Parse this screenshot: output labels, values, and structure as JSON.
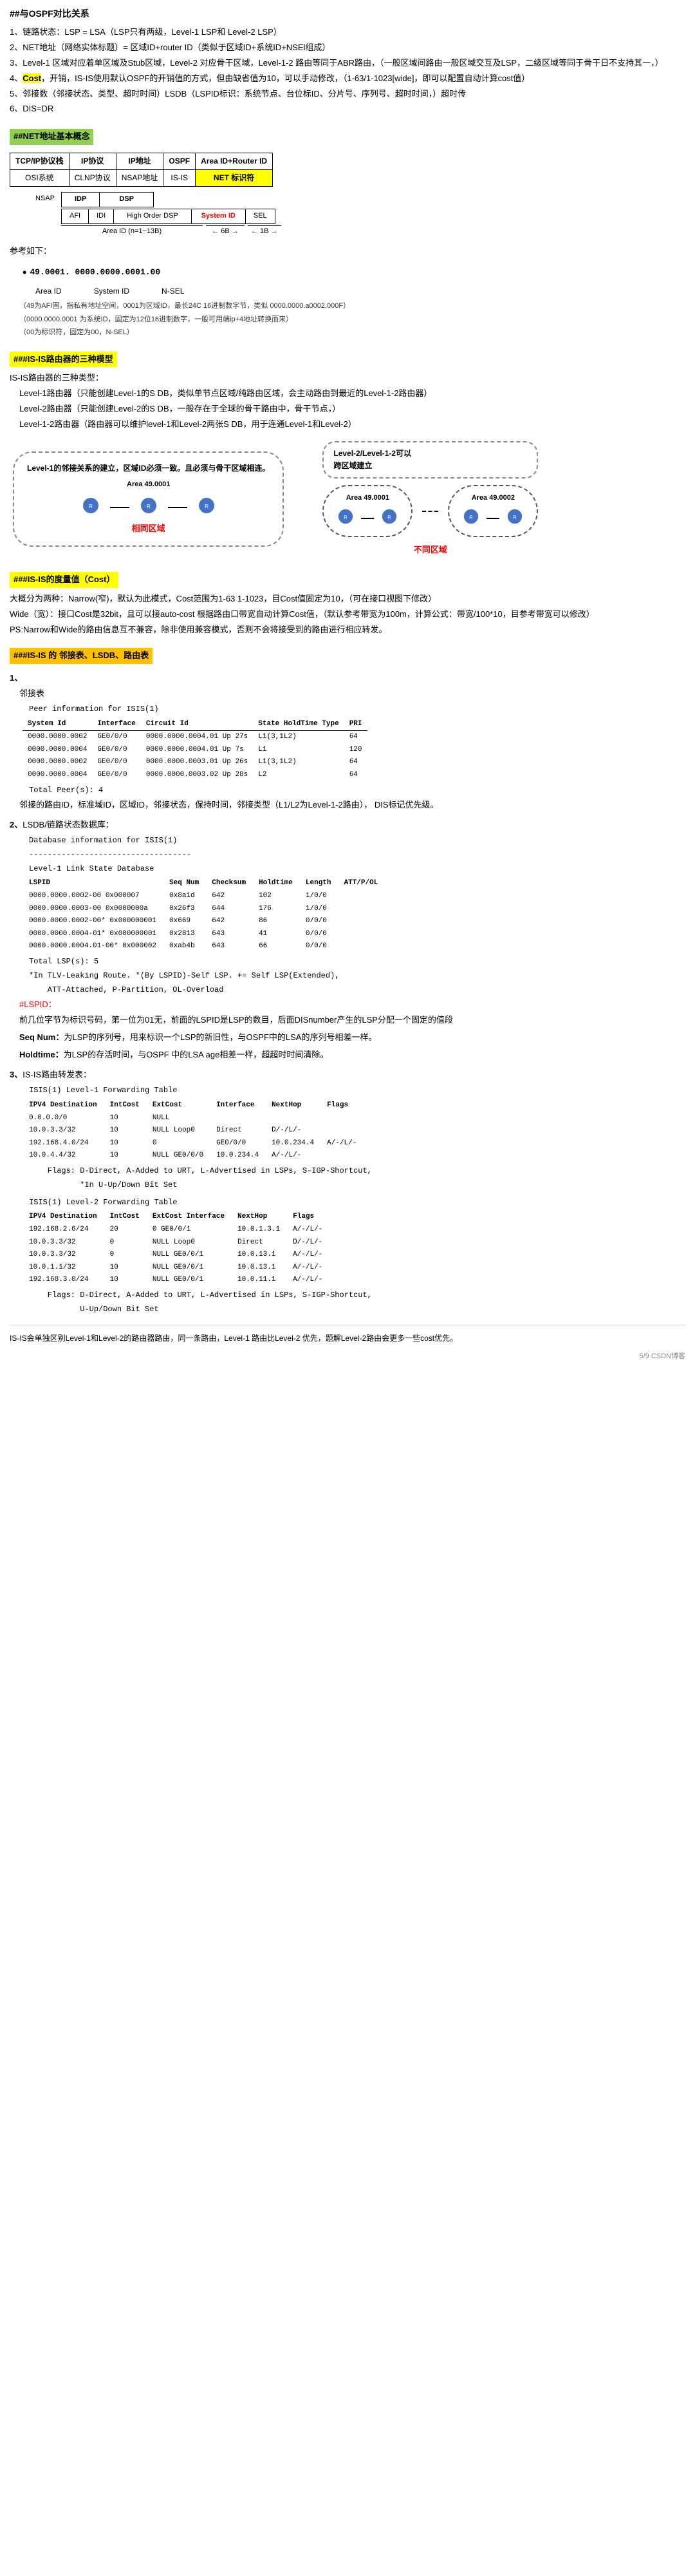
{
  "page": {
    "title": "##与OSPF对比关系",
    "footer": "5/9 CSDN博客"
  },
  "sections": {
    "ospf_compare": {
      "items": [
        "1、链路状态：LSP = LSA（LSP只有两级，Level-1 LSP和 Level-2 LSP）",
        "2、NET地址（网络实体标题）= 区域ID+router ID（类似于区域ID+系统ID+NSEl组成）",
        "3、Level-1 区域对应着单区域及Stub区域，Level-2 对应骨干区域，Level-1-2 路由等同于ABR路由，（一般区域间路由一般区域交互及LSP，二级区域等同于骨干日不支持其一，）",
        "4、Cost，开销，IS-IS使用默认OSPF的开销值的方式，但由缺省值为10，可以手动修改，（1-63/1-1023[wide]，即可以配置自动计算cost值）",
        "5、邻接数（邻接状态、类型、超时时间）LSDB（LSPID标识：系统节点、台位标ID、分片号、序列号、超时时间，）超时传",
        "6、DIS=DR"
      ]
    },
    "net_section": {
      "heading": "##NET地址基本概念",
      "table_headers": [
        "TCP/IP协议栈",
        "IP协议",
        "IP地址",
        "OSPF",
        "Area ID+Router ID"
      ],
      "table_row": [
        "OSI系统",
        "CLNP协议",
        "NSAP地址",
        "IS-IS",
        "NET 标识符"
      ],
      "nsap_label": "NSAP",
      "nsap_fields": [
        "IDP",
        "",
        "DSP"
      ],
      "nsap_sub_fields": [
        "AFI",
        "IDI",
        "High Order DSP",
        "System ID",
        "SEL"
      ],
      "area_id_label": "Area ID (n=1~13B)",
      "area_id_arrow": "← 6B →",
      "sel_arrow": "← 1B →"
    },
    "example": {
      "heading": "参考如下：",
      "addr": "49.0001. 0000.0000.0001.00",
      "area_id": "Area ID",
      "system_id": "System ID",
      "n_sel": "N-SEL",
      "note1": "（49为AFI固，指私有地址空间，0001为区域ID，最长24C 16进制数字节，类似 0000.0000.a0002.000F）",
      "note2": "（0000.0000.0001 为系统ID，固定为12位16进制数字，一般可用端ip+4地址转换而来）",
      "note3": "（00为标识符，固定为00，N-SEL）"
    },
    "isis_routing": {
      "heading": "###IS-IS路由器的三种模型",
      "desc": "IS-IS路由器的三种类型：",
      "level1": "Level-1路由器（只能创建Level-1的S DB，类似单节点区域/纯路由区域，会主动路由到最近的Level-1-2路由器）",
      "level2": "Level-2路由器（只能创建Level-2的S DB，一般存在于全球的骨干路由中，骨干节点，）",
      "level12": "Level-1-2路由器（路由器可以维护level-1和Level-2两张S DB，用于连通Level-1和Level-2）",
      "diagram_left": {
        "title": "Level-1的邻接关系的建立，区域ID必须一致。且必须与骨干区域相连。",
        "area": "Area 49.0001",
        "label": "相同区域"
      },
      "diagram_right": {
        "title": "Level-2/Level-1-2可以跨区域建立",
        "area1": "Area 49.0001",
        "area2": "Area 49.0002",
        "label": "不同区域"
      }
    },
    "cost_section": {
      "heading": "###IS-IS的度量值（Cost）",
      "desc": "大概分为两种：Narrow(窄)，默认为此模式，Cost范围为1-63 1-1023，目Cost值固定为10，（可在接口视图下修改）",
      "wide": "Wide（宽）：接口Cost是32bit，且可以接auto-cost 根据路由口带宽自动计算Cost值，（默认参考带宽为100m，计算公式：带宽/100*10，目参考带宽可以修改）",
      "ps": "PS:Narrow和Wide的路由信息互不兼容，除非使用兼容模式，否则不会将接受到的路由进行相应转发。"
    },
    "pis_heading": "###IS-IS 的 邻接表、LSDB、路由表",
    "sub_sections": {
      "peer": {
        "num": "1.",
        "label": "邻接表",
        "title": "Peer information for ISIS(1)",
        "headers": [
          "System Id",
          "Interface",
          "Circuit Id",
          "State HoldTime Type",
          "PRI"
        ],
        "rows": [
          [
            "0000.0000.0002",
            "GE0/0/0",
            "0000.0000.0004.01 Up 27s",
            "L1(3,1L2)",
            "64"
          ],
          [
            "0000.0000.0004",
            "GE0/0/0",
            "0000.0000.0004.01 Up 7s",
            "L1",
            "120"
          ],
          [
            "0000.0000.0002",
            "GE0/0/0",
            "0000.0000.0003.01 Up 26s",
            "L1(3,1L2)",
            "64"
          ],
          [
            "0000.0000.0004",
            "GE0/0/0",
            "0000.0000.0003.02 Up 28s",
            "L2",
            "64"
          ]
        ],
        "total": "Total Peer(s): 4",
        "note": "邻接的路由ID，标准域ID，区域ID，邻接状态，保持时间，邻接类型（L1/L2为Level-1-2路由）， DIS标记优先级。"
      },
      "lsdb": {
        "num": "2.",
        "label": "LSDB/链路状态数据库：",
        "title": "Database information for ISIS(1)",
        "divider": "-----------------------------------",
        "level1": "Level-1 Link State Database",
        "headers": [
          "LSPID",
          "Seq Num",
          "Checksum",
          "Holdtime",
          "Length",
          "ATT/P/OL"
        ],
        "rows": [
          [
            "0000.0000.0002-00 0x000007",
            "0x8a1d",
            "642",
            "102",
            "1/0/0"
          ],
          [
            "0000.0000.0003-00 0x0000000a",
            "0x26f3",
            "644",
            "176",
            "1/0/0"
          ],
          [
            "0000.0000.0002-00* 0x000000001",
            "0x669",
            "642",
            "86",
            "0/0/0"
          ],
          [
            "0000.0000.0004-01* 0x000000001",
            "0x2813",
            "643",
            "41",
            "0/0/0"
          ],
          [
            "0000.0000.0004.01-00* 0x000002",
            "0xab4b",
            "643",
            "66",
            "0/0/0"
          ]
        ],
        "total": "Total LSP(s): 5",
        "flags": "*In TLV-Leaking Route. *(By LSPID)-Self LSP. += Self LSP(Extended),",
        "att_label": "ATT-Attached, P-Partition, OL-Overload",
        "att_note": "#LSPID：",
        "lspid_desc": "前几位字节为标识号码，第一位为01无，前面的LSPID是LSP的数目，后面DISnumber产生的LSP分配一个固定的值段",
        "seqnum_title": "Seq Num：为LSP的序列号，用来标识一个LSP的新旧性，与OSPF中的LSA的序列号相差一样。",
        "holdtime_title": "Holdtime：为LSP的存活时间，与OSPF 中的LSA age相差一样，超超时时间清除。"
      },
      "routing": {
        "num": "3.",
        "label": "IS-IS路由转发表：",
        "level1_title": "ISIS(1) Level-1 Forwarding Table",
        "fwd_headers": [
          "IPV4 Destination",
          "IntCost",
          "ExtCost",
          "Interface",
          "NextHop",
          "Flags"
        ],
        "fwd_rows_l1": [
          [
            "0.0.0.0/0",
            "10",
            "NULL",
            "",
            "",
            ""
          ],
          [
            "10.0.3.3/32",
            "10",
            "NULL Loop0",
            "Direct",
            "D/-/L/-"
          ],
          [
            "192.168.4.0/24",
            "10",
            "0",
            "GE0/0/0",
            "10.0.234.4",
            "A/-/L/-"
          ],
          [
            "10.0.4.4/32",
            "10",
            "NULL GE0/0/0",
            "10.0.234.4",
            "A/-/L/-",
            ""
          ],
          [
            "flags_note",
            "Flags: D-Direct, A-Added to URT, L-Advertised in LSPs, S-IGP-Shortcut,",
            "",
            "",
            "",
            ""
          ],
          [
            "updown",
            "*In U-Up/Down Bit Set",
            "",
            "",
            "",
            ""
          ]
        ],
        "level2_title": "ISIS(1) Level-2 Forwarding Table",
        "fwd_headers_l2": [
          "IPV4 Destination",
          "IntCost",
          "ExtCost Interface",
          "NextHop",
          "Flags"
        ],
        "fwd_rows_l2": [
          [
            "192.168.2.6/24",
            "20",
            "0",
            "GE0/0/1",
            "10.0.1.3.1",
            "A/-/L/-"
          ],
          [
            "10.0.3.3/32",
            "0",
            "NULL",
            "Loop0",
            "Direct",
            "D/-/L/-"
          ],
          [
            "10.0.3.3/32",
            "0",
            "NULL GE0/0/1",
            "10.0.13.1",
            "A/-/L/-",
            ""
          ],
          [
            "10.0.1.1/32",
            "10",
            "NULL GE0/0/1",
            "10.0.13.1",
            "A/-/L/-",
            ""
          ],
          [
            "192.168.3.0/24",
            "10",
            "NULL GE0/0/1",
            "10.0.11.1",
            "A/-/L/-",
            ""
          ],
          [
            "flags_note2",
            "Flags: D-Direct, A-Added to URT, L-Advertised in LSPs, S-IGP-Shortcut,",
            "",
            "",
            "",
            ""
          ],
          [
            "updown2",
            "U-Up/Down Bit Set",
            "",
            "",
            "",
            ""
          ]
        ]
      }
    },
    "bottom_note": "IS-IS会单独区别Level-1和Level-2的路由器路由，同一条路由，Level-1 路由比Level-2 优先，题解Level-2路由会更多一些cost优先。"
  }
}
